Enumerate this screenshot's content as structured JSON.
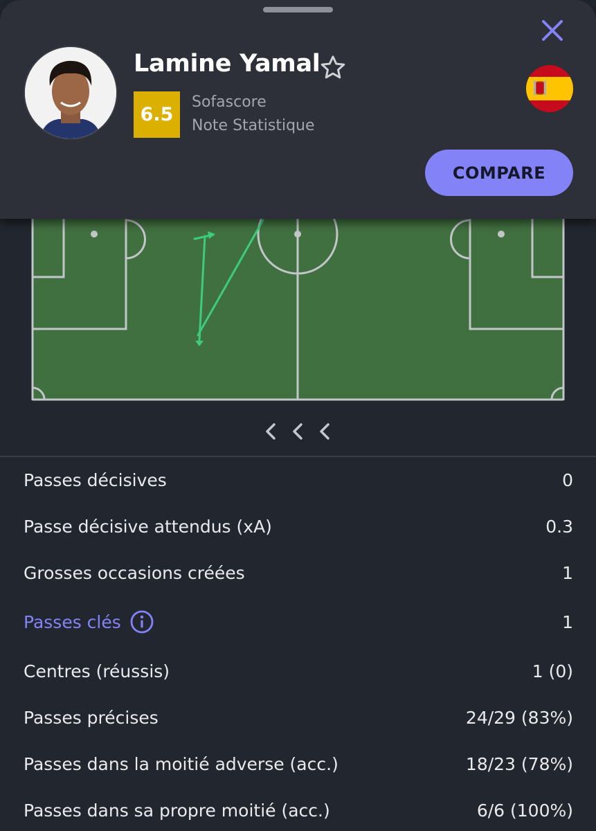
{
  "header": {
    "player_name": "Lamine Yamal",
    "rating": "6.5",
    "rating_source": "Sofascore",
    "rating_label": "Note Statistique",
    "compare_label": "COMPARE",
    "flag_country": "Spain",
    "icons": {
      "close": "close-icon",
      "favorite": "star-outline-icon",
      "info": "info-circle-icon",
      "chevrons": "chevron-left-icon"
    },
    "colors": {
      "accent": "#8383f7",
      "rating_badge": "#dcb000",
      "pitch": "#417040",
      "pass_lines": "#3ecb7f"
    }
  },
  "stats": [
    {
      "label": "Passes décisives",
      "value": "0"
    },
    {
      "label": "Passe décisive attendus (xA)",
      "value": "0.3"
    },
    {
      "label": "Grosses occasions créées",
      "value": "1"
    },
    {
      "label": "Passes clés",
      "value": "1"
    },
    {
      "label": "Centres (réussis)",
      "value": "1 (0)"
    },
    {
      "label": "Passes précises",
      "value": "24/29 (83%)"
    },
    {
      "label": "Passes dans la moitié adverse (acc.)",
      "value": "18/23 (78%)"
    },
    {
      "label": "Passes dans sa propre moitié (acc.)",
      "value": "6/6 (100%)"
    }
  ]
}
